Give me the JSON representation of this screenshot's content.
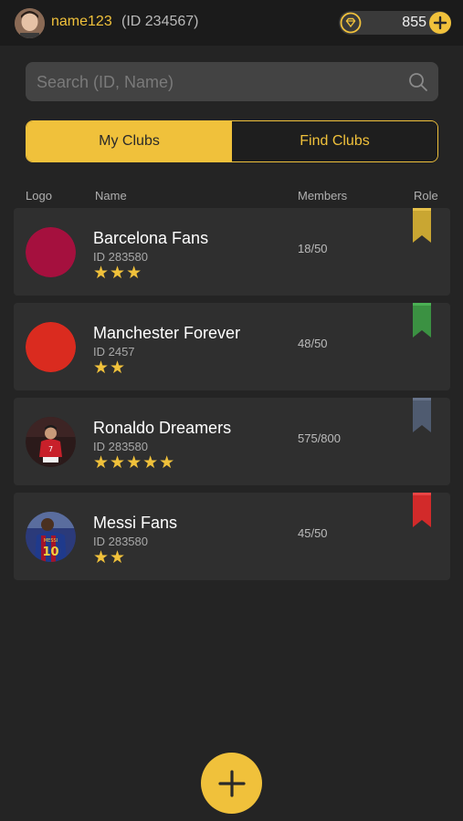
{
  "header": {
    "username": "name123",
    "user_id": "(ID 234567)",
    "coins": "855",
    "accent_color": "#f0c13b"
  },
  "search": {
    "placeholder": "Search (ID, Name)",
    "value": ""
  },
  "tabs": [
    {
      "label": "My Clubs",
      "active": true
    },
    {
      "label": "Find Clubs",
      "active": false
    }
  ],
  "columns": {
    "logo": "Logo",
    "name": "Name",
    "members": "Members",
    "role": "Role"
  },
  "clubs": [
    {
      "name": "Barcelona Fans",
      "id": "ID 283580",
      "stars": "★★★",
      "members": "18/50",
      "logo_color": "#a5103e",
      "role_color": "#c9a632",
      "logo_type": "solid"
    },
    {
      "name": "Manchester Forever",
      "id": "ID 2457",
      "stars": "★★",
      "members": "48/50",
      "logo_color": "#da2b1f",
      "role_color": "#3b9142",
      "logo_type": "solid"
    },
    {
      "name": "Ronaldo Dreamers",
      "id": "ID 283580",
      "stars": "★★★★★",
      "members": "575/800",
      "logo_color": "#3a1c1c",
      "role_color": "#4f5b70",
      "logo_type": "photo"
    },
    {
      "name": "Messi Fans",
      "id": "ID 283580",
      "stars": "★★",
      "members": "45/50",
      "logo_color": "#2b3a7a",
      "role_color": "#d22a2a",
      "logo_type": "photo"
    }
  ],
  "icons": {
    "coin": "coin-icon",
    "add": "plus-icon",
    "search": "search-icon",
    "fab": "plus-icon"
  }
}
